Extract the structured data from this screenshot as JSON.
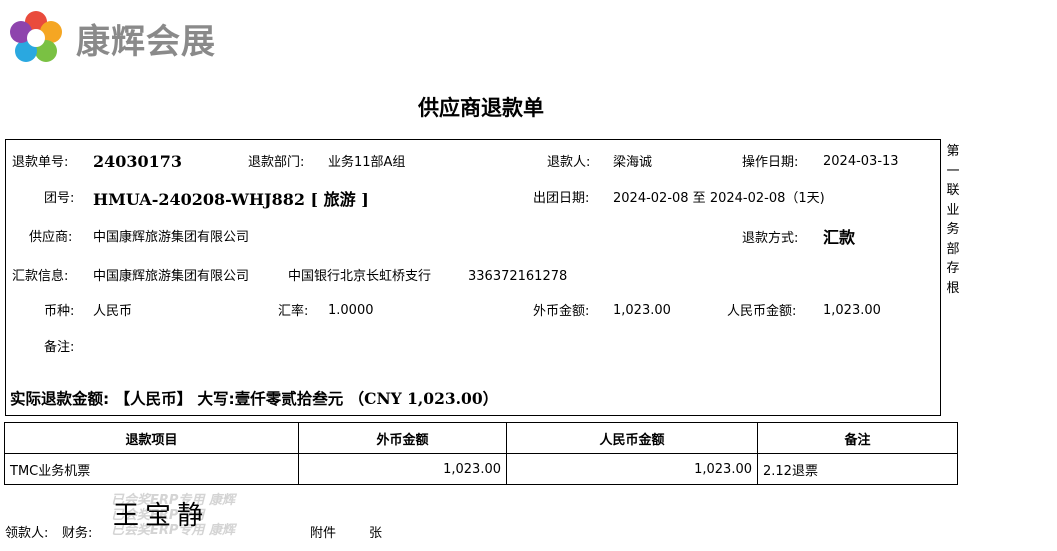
{
  "company": {
    "name": "康辉会展",
    "logo_colors": [
      "#e94b3c",
      "#f5a623",
      "#7ac143",
      "#2aa8e0",
      "#8e44ad"
    ]
  },
  "document": {
    "title": "供应商退款单"
  },
  "fields": {
    "refund_no_label": "退款单号:",
    "refund_no": "24030173",
    "dept_label": "退款部门:",
    "dept": "业务11部A组",
    "person_label": "退款人:",
    "person": "梁海诚",
    "op_date_label": "操作日期:",
    "op_date": "2024-03-13",
    "group_label": "团号:",
    "group_no": "HMUA-240208-WHJ882 [ 旅游 ]",
    "depart_label": "出团日期:",
    "depart": "2024-02-08 至 2024-02-08（1天)",
    "supplier_label": "供应商:",
    "supplier": "中国康辉旅游集团有限公司",
    "method_label": "退款方式:",
    "method": "汇款",
    "remit_label": "汇款信息:",
    "remit_company": "中国康辉旅游集团有限公司",
    "remit_bank": "中国银行北京长虹桥支行",
    "remit_account": "336372161278",
    "currency_label": "币种:",
    "currency": "人民币",
    "rate_label": "汇率:",
    "rate": "1.0000",
    "foreign_label": "外币金额:",
    "foreign_amount": "1,023.00",
    "rmb_label": "人民币金额:",
    "rmb_amount": "1,023.00",
    "remark_label": "备注:"
  },
  "total": {
    "label": "实际退款金额:",
    "currency_tag": "【人民币】",
    "uppercase_label": "大写:",
    "uppercase": "壹仟零贰拾叁元",
    "cny": "（CNY 1,023.00）"
  },
  "side_note": "第一联业务部存根",
  "table": {
    "headers": [
      "退款项目",
      "外币金额",
      "人民币金额",
      "备注"
    ],
    "rows": [
      [
        "TMC业务机票",
        "1,023.00",
        "1,023.00",
        "2.12退票"
      ]
    ]
  },
  "footer": {
    "receiver_label": "领款人:",
    "finance_label": "财务:",
    "attach_label": "附件",
    "attach_unit": "张",
    "signature": "王宝静",
    "stamp_text": [
      "已会奖ERP专用 康辉",
      "已会奖ERP专用",
      "已会奖ERP专用 康辉"
    ]
  }
}
